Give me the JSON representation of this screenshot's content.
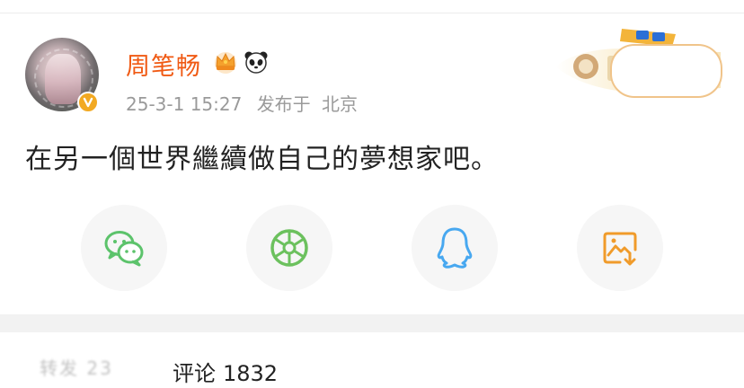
{
  "post": {
    "username": "周笔畅",
    "time": "25-3-1 15:27",
    "posted_at_label": "发布于",
    "location": "北京",
    "text": "在另一個世界繼續做自己的夢想家吧。",
    "badges": [
      "crown-icon",
      "panda-icon"
    ],
    "verified_icon": "verified-v-icon"
  },
  "share": {
    "buttons": [
      {
        "icon": "wechat-icon",
        "color": "#5cc36b"
      },
      {
        "icon": "moments-icon",
        "color": "#6cc15e"
      },
      {
        "icon": "qq-icon",
        "color": "#48a8f0"
      },
      {
        "icon": "save-image-icon",
        "color": "#f09b2a"
      }
    ]
  },
  "tabs": {
    "reposts": "转发 23",
    "comments_label": "评论",
    "comments_count": "1832"
  },
  "colors": {
    "username": "#f05a14",
    "meta": "#9a9a9a",
    "text": "#222222",
    "verified": "#f2a922"
  }
}
